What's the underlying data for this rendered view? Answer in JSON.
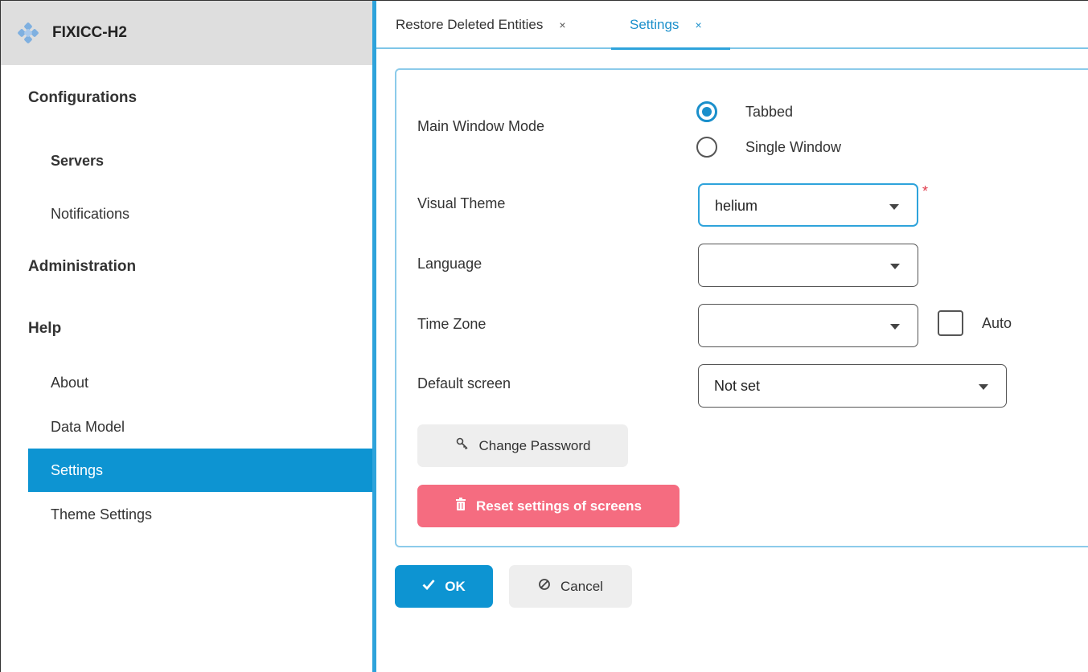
{
  "app": {
    "title": "FIXICC-H2",
    "logo_icon": "fixicc-logo"
  },
  "sidebar": {
    "groups": [
      {
        "label": "Configurations"
      },
      {
        "label": "Administration"
      },
      {
        "label": "Help"
      }
    ],
    "items": [
      {
        "label": "Servers"
      },
      {
        "label": "Notifications"
      },
      {
        "label": "About"
      },
      {
        "label": "Data Model"
      },
      {
        "label": "Settings",
        "active": true
      },
      {
        "label": "Theme Settings"
      }
    ]
  },
  "tabs": [
    {
      "label": "Restore Deleted Entities",
      "close": "×"
    },
    {
      "label": "Settings",
      "close": "×",
      "active": true
    }
  ],
  "form": {
    "main_window_mode": {
      "label": "Main Window Mode",
      "options": [
        "Tabbed",
        "Single Window"
      ],
      "selected": "Tabbed"
    },
    "visual_theme": {
      "label": "Visual Theme",
      "value": "helium",
      "required_mark": "*"
    },
    "language": {
      "label": "Language",
      "value": ""
    },
    "time_zone": {
      "label": "Time Zone",
      "value": "",
      "auto_label": "Auto",
      "auto_checked": false
    },
    "default_screen": {
      "label": "Default screen",
      "value": "Not set"
    },
    "change_password": {
      "label": "Change Password",
      "icon": "key-icon"
    },
    "reset_settings": {
      "label": "Reset settings of screens",
      "icon": "trash-icon"
    }
  },
  "footer": {
    "ok": {
      "label": "OK",
      "icon": "check-icon"
    },
    "cancel": {
      "label": "Cancel",
      "icon": "cancel-icon"
    }
  },
  "colors": {
    "accent": "#0d94d2",
    "danger": "#f56c80",
    "sidebar_header": "#dedede"
  }
}
